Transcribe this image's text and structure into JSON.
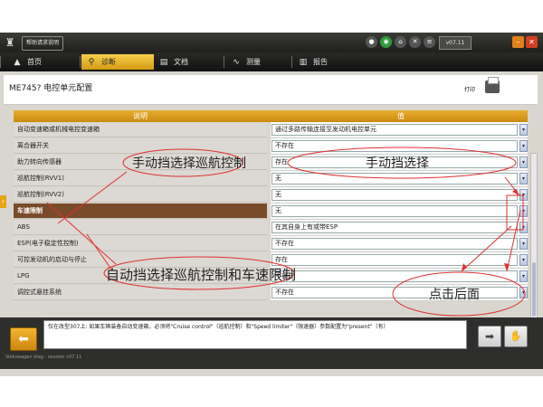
{
  "app": {
    "help_tab": "帮助请求说明",
    "version": "v07.11",
    "status_line": "Volkswagen diag - session v07.11"
  },
  "nav": {
    "tabs": [
      {
        "label": "首页",
        "icon": "home-icon"
      },
      {
        "label": "诊断",
        "icon": "diagnostic-icon",
        "active": true
      },
      {
        "label": "文档",
        "icon": "document-icon"
      },
      {
        "label": "测量",
        "icon": "measurement-icon"
      },
      {
        "label": "报告",
        "icon": "report-icon"
      }
    ]
  },
  "page": {
    "title": "ME745?  电控单元配置",
    "print_label": "打印"
  },
  "table": {
    "col_description": "说明",
    "col_value": "值",
    "rows": [
      {
        "label": "自动变速箱或机械电控变速箱",
        "value": "通过多路传输连接至发动机电控单元"
      },
      {
        "label": "离合器开关",
        "value": "不存在"
      },
      {
        "label": "助力转向传感器",
        "value": "存在"
      },
      {
        "label": "巡航控制(RVV1)",
        "value": "无"
      },
      {
        "label": "巡航控制(RVV2)",
        "value": "无"
      },
      {
        "label": "车速限制",
        "value": "无",
        "highlighted": true
      },
      {
        "label": "ABS",
        "value": "在其自身上有或带ESP"
      },
      {
        "label": "ESP(电子稳定性控制)",
        "value": "不存在"
      },
      {
        "label": "可控发动机的启动与停止",
        "value": "存在"
      },
      {
        "label": "LPG",
        "value": "不存在"
      },
      {
        "label": "调控式悬挂系统",
        "value": "不存在"
      }
    ]
  },
  "footer": {
    "message": "仅在改型307上: 如果车辆装备自动变速箱，必须将\"Cruise control\"（巡航控制）和\"Speed limiter\"（限速器）参数配置为\"present\"（有）"
  },
  "annotations": {
    "manual_cruise": "手动挡选择巡航控制",
    "manual_select": "手动挡选择",
    "auto_cruise_limit": "自动挡选择巡航控制和车速限制",
    "click_after": "点击后面"
  },
  "colors": {
    "accent": "#e8a317",
    "row_highlight": "#7a4b2a",
    "annotation": "#e03030"
  }
}
